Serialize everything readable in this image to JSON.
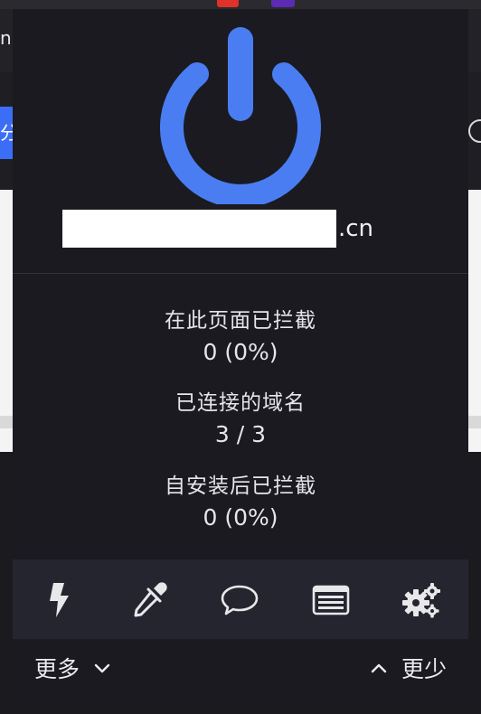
{
  "background": {
    "tab_text": "ni",
    "blue_button_text": "分"
  },
  "popup": {
    "hostname_suffix": ".cn",
    "stats": [
      {
        "label": "在此页面已拦截",
        "value": "0 (0%)"
      },
      {
        "label": "已连接的域名",
        "value": "3 / 3"
      },
      {
        "label": "自安装后已拦截",
        "value": "0 (0%)"
      }
    ],
    "toolbar": {
      "icons": [
        "lightning-icon",
        "eyedropper-icon",
        "speech-bubble-icon",
        "logger-list-icon",
        "gears-icon"
      ]
    },
    "more_label": "更多",
    "less_label": "更少",
    "colors": {
      "accent": "#4a7df2",
      "panel_bg": "#1a1a20",
      "toolbar_bg": "#24252e"
    }
  }
}
